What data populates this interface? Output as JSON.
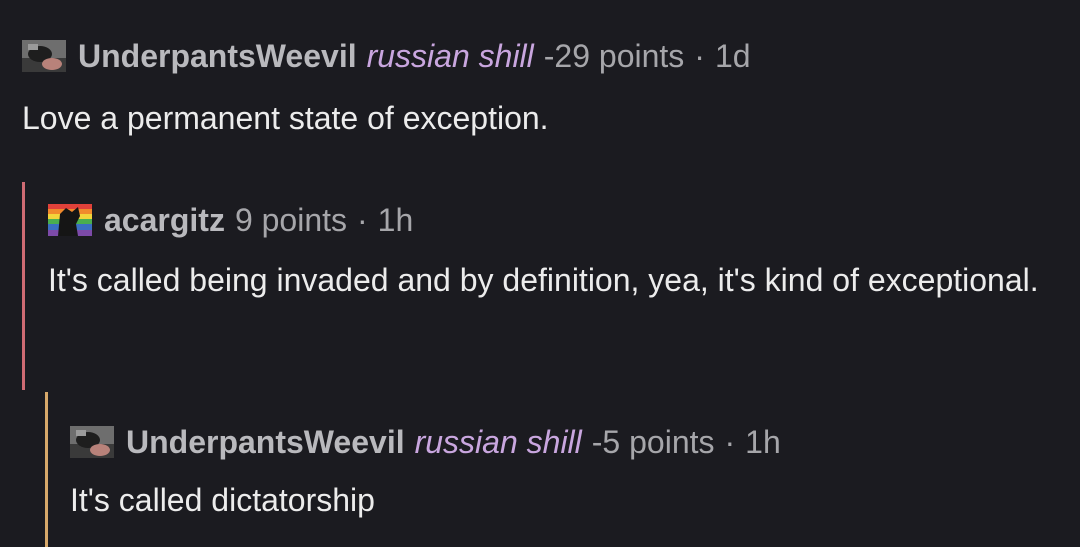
{
  "comments": [
    {
      "username": "UnderpantsWeevil",
      "flair": "russian shill",
      "points": "-29 points",
      "separator": "·",
      "time": "1d",
      "avatar_icon": "weevil-avatar-icon",
      "body": "Love a permanent state of exception."
    },
    {
      "username": "acargitz",
      "points": "9 points",
      "separator": "·",
      "time": "1h",
      "avatar_icon": "rainbow-avatar-icon",
      "body": "It's called being invaded and by definition, yea, it's kind of exceptional."
    },
    {
      "username": "UnderpantsWeevil",
      "flair": "russian shill",
      "points": "-5 points",
      "separator": "·",
      "time": "1h",
      "avatar_icon": "weevil-avatar-icon",
      "body": "It's called dictatorship"
    }
  ],
  "colors": {
    "background": "#1b1b20",
    "thread_bar_level1": "#cf6b73",
    "thread_bar_level2": "#d7a86a",
    "flair": "#c9a6df"
  }
}
